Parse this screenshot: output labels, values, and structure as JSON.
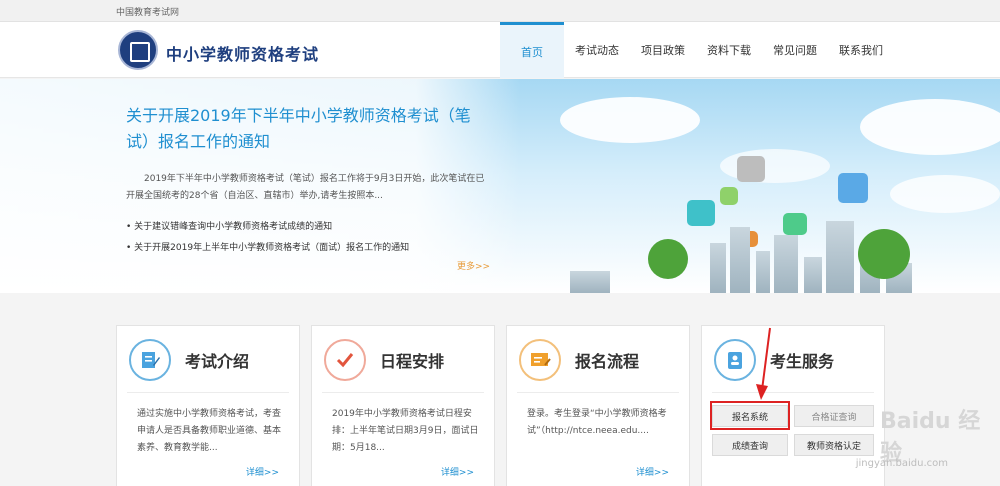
{
  "top_bar": {
    "label": "中国教育考试网"
  },
  "header": {
    "title": "中小学教师资格考试",
    "nav": [
      {
        "label": "首页",
        "active": true
      },
      {
        "label": "考试动态"
      },
      {
        "label": "项目政策"
      },
      {
        "label": "资料下载"
      },
      {
        "label": "常见问题"
      },
      {
        "label": "联系我们"
      }
    ]
  },
  "banner": {
    "headline": "关于开展2019年下半年中小学教师资格考试（笔试）报名工作的通知",
    "summary": "2019年下半年中小学教师资格考试（笔试）报名工作将于9月3日开始，此次笔试在已开展全国统考的28个省（自治区、直辖市）举办,请考生按照本...",
    "news": [
      "关于建议错峰查询中小学教师资格考试成绩的通知",
      "关于开展2019年上半年中小学教师资格考试（面试）报名工作的通知"
    ],
    "more": "更多>>"
  },
  "cards": [
    {
      "title": "考试介绍",
      "icon": "document-edit-icon",
      "text": "通过实施中小学教师资格考试，考查申请人是否具备教师职业道德、基本素养、教育教学能...",
      "more": "详细>>"
    },
    {
      "title": "日程安排",
      "icon": "checkmark-icon",
      "text": "2019年中小学教师资格考试日程安排：上半年笔试日期3月9日，面试日期：5月18...",
      "more": "详细>>"
    },
    {
      "title": "报名流程",
      "icon": "form-icon",
      "text": "登录。考生登录“中小学教师资格考试”（http://ntce.neea.edu....",
      "more": "详细>>"
    },
    {
      "title": "考生服务",
      "icon": "address-book-icon"
    }
  ],
  "services": {
    "register": "报名系统",
    "hidden_top": "合格证查询",
    "score": "成绩查询",
    "certification": "教师资格认定"
  },
  "watermark": {
    "brand": "Baidu 经验",
    "url": "jingyan.baidu.com"
  },
  "colors": {
    "primary": "#1f8fd0",
    "brand": "#1f3f7f",
    "accent": "#e89c3b",
    "highlight": "#d22222"
  }
}
